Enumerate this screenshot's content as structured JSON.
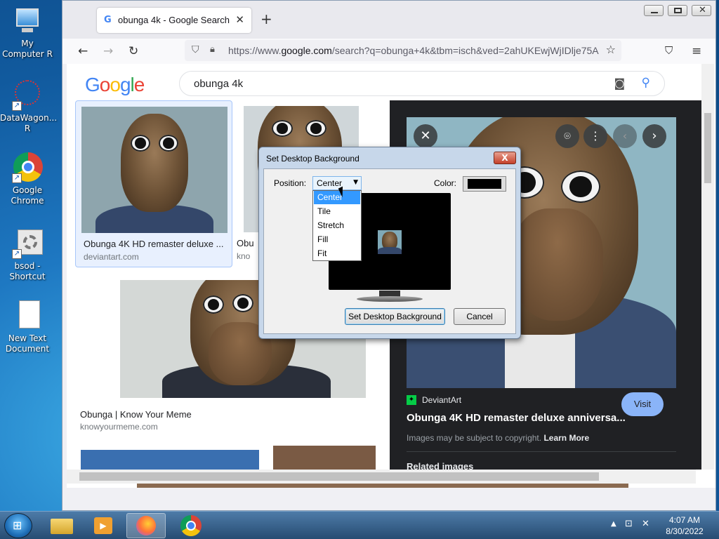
{
  "desktop": {
    "icons": [
      {
        "label": "My Computer",
        "label_suffix": "R"
      },
      {
        "label": "DataWagon...",
        "label_suffix": "R"
      },
      {
        "label": "Google Chrome"
      },
      {
        "label": "bsod - Shortcut"
      },
      {
        "label": "New Text Document"
      }
    ]
  },
  "browser": {
    "tab_title": "obunga 4k - Google Search",
    "new_tab_symbol": "+",
    "url_prefix": "https://www.",
    "url_domain": "google.com",
    "url_rest": "/search?q=obunga+4k&tbm=isch&ved=2ahUKEwjWjIDlje75A",
    "nav": {
      "back": "←",
      "forward": "→",
      "reload": "↻"
    }
  },
  "google": {
    "logo_letters": [
      "G",
      "o",
      "o",
      "g",
      "l",
      "e"
    ],
    "logo_colors": [
      "#4285f4",
      "#ea4335",
      "#fbbc05",
      "#4285f4",
      "#34a853",
      "#ea4335"
    ],
    "query": "obunga 4k"
  },
  "results": [
    {
      "caption": "Obunga 4K HD remaster deluxe ...",
      "source": "deviantart.com"
    },
    {
      "caption": "Obu",
      "source": "kno"
    },
    {
      "caption": "Obunga | Know Your Meme",
      "source": "knowyourmeme.com"
    }
  ],
  "preview": {
    "site_name": "DeviantArt",
    "title": "Obunga 4K HD remaster deluxe anniversa...",
    "visit_label": "Visit",
    "copyright_text": "Images may be subject to copyright.",
    "learn_more": "Learn More",
    "related": "Related images"
  },
  "dialog": {
    "title": "Set Desktop Background",
    "close_symbol": "X",
    "position_label": "Position:",
    "position_value": "Center",
    "color_label": "Color:",
    "color_value": "#000000",
    "options": [
      "Center",
      "Tile",
      "Stretch",
      "Fill",
      "Fit"
    ],
    "selected_option": "Center",
    "set_button": "Set Desktop Background",
    "cancel_button": "Cancel"
  },
  "taskbar": {
    "time": "4:07 AM",
    "date": "8/30/2022"
  }
}
